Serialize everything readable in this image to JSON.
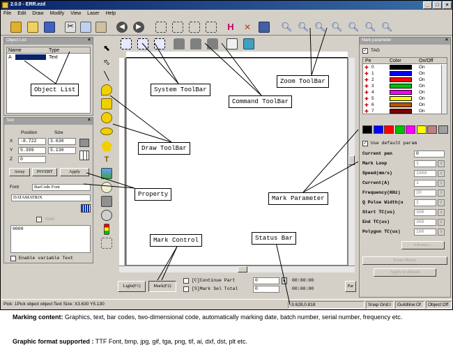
{
  "window": {
    "title": "2.0.0 - ERR.ezd",
    "min": "_",
    "max": "□",
    "close": "×"
  },
  "menu": [
    "File",
    "Edit",
    "Draw",
    "Modify",
    "View",
    "Laser",
    "Help"
  ],
  "object_list": {
    "title": "Object List",
    "columns": [
      "Name",
      "Type"
    ],
    "rows": [
      {
        "name": "A",
        "type": "Text"
      }
    ]
  },
  "text_panel": {
    "title": "Text",
    "position_label": "Position",
    "size_label": "Size",
    "x_label": "X",
    "y_label": "Y",
    "z_label": "Z",
    "x_pos": "-8.722",
    "x_size": "3.630",
    "y_pos": "5.399",
    "y_size": "5.130",
    "z_pos": "0",
    "array_btn": "Array",
    "invert_btn": "INVERT",
    "apply_btn": "Apply",
    "font_label": "Font",
    "font_value": "BarCode Font",
    "barcode_value": "DATAMATRIX",
    "valid_label": "Valid",
    "text_value": "0000",
    "enable_variable": "Enable variable Text"
  },
  "mark_parameter": {
    "title": "Mark parameter",
    "tag_label": "TAG",
    "columns": [
      "Pe",
      "Color",
      "On/Off"
    ],
    "pens": [
      {
        "no": "0",
        "color": "#000000",
        "state": "On"
      },
      {
        "no": "1",
        "color": "#0000ff",
        "state": "On"
      },
      {
        "no": "2",
        "color": "#ff0000",
        "state": "On"
      },
      {
        "no": "3",
        "color": "#00c000",
        "state": "On"
      },
      {
        "no": "4",
        "color": "#ff00ff",
        "state": "On"
      },
      {
        "no": "5",
        "color": "#ffff00",
        "state": "On"
      },
      {
        "no": "6",
        "color": "#c05000",
        "state": "On"
      },
      {
        "no": "7",
        "color": "#800000",
        "state": "On"
      }
    ],
    "palette": [
      "#000000",
      "#0000ff",
      "#ff0000",
      "#00c000",
      "#ff00ff",
      "#ffff00",
      "#c08080",
      "#a0a0a0"
    ],
    "use_default": "Use default param",
    "params": [
      {
        "label": "Current pen",
        "value": "0"
      },
      {
        "label": "Mark Loop",
        "value": "1"
      },
      {
        "label": "Speed(mm/s)",
        "value": "1000"
      },
      {
        "label": "Current(A)",
        "value": "1"
      },
      {
        "label": "Frequency(KHz)",
        "value": "20"
      },
      {
        "label": "Q Pulse Width(u",
        "value": "1"
      },
      {
        "label": "Start TC(us)",
        "value": "300"
      },
      {
        "label": "End TC(us)",
        "value": "300"
      },
      {
        "label": "Polygon TC(us)",
        "value": "100"
      }
    ],
    "advance_btn": "Advance...",
    "from_library_btn": "From library",
    "apply_default_btn": "Apply to default"
  },
  "mark_control": {
    "light_btn": "Light(F1)",
    "mark_btn": "Mark(F2)",
    "continue_label": "[C]Continue Part",
    "sel_label": "[S]Mark Sel  Total",
    "part_value": "0",
    "total_value": "0",
    "time1": "00:00:00",
    "time2": "00:00:00",
    "para_btn": "Par"
  },
  "status": {
    "left": "Pick: 1Pick object object:Text Size: X3.630 Y5.130",
    "coords": "-3.628,0.818",
    "snap": "Snap Grid:I",
    "guideline": "Guildline:Of",
    "object": "Object:Off"
  },
  "callouts": {
    "object_list": "Object List",
    "system_toolbar": "System ToolBar",
    "command_toolbar": "Command ToolBar",
    "zoom_toolbar": "Zoom ToolBar",
    "draw_toolbar": "Draw ToolBar",
    "property": "Property",
    "mark_parameter": "Mark Parameter",
    "mark_control": "Mark Control",
    "status_bar": "Status Bar"
  },
  "caption": {
    "marking_label": "Marking content:",
    "marking_text": "Graphics, text, bar codes, two-dimensional code, automatically marking date, batch number, serial number, frequency etc.",
    "format_label": "Graphic format supported :",
    "format_text": "TTF Font, bmp, jpg, gif, tga, png, tif, ai, dxf, dst, plt etc."
  }
}
